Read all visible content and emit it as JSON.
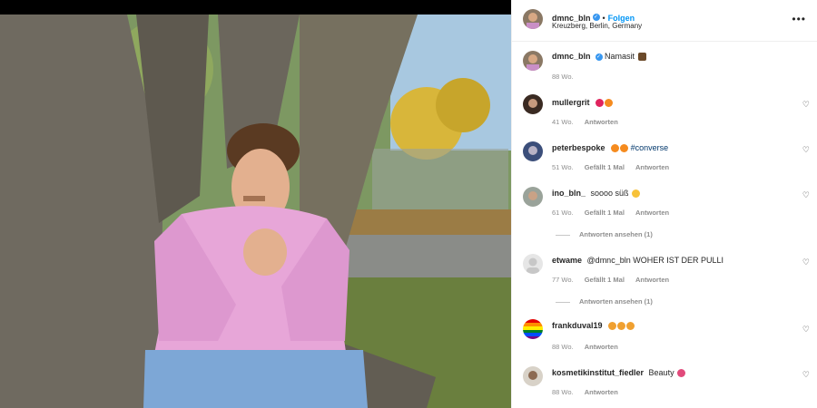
{
  "post": {
    "author": "dmnc_bln",
    "follow_label": "Folgen",
    "dot": "•",
    "location": "Kreuzberg, Berlin, Germany",
    "more": "•••",
    "verified_mark": "✓",
    "caption_text": "Namasit",
    "caption_age": "88 Wo."
  },
  "comments": [
    {
      "user": "mullergrit",
      "text": "",
      "emoji": [
        "heart-red",
        "fire"
      ],
      "age": "41 Wo.",
      "likes": "",
      "reply": "Antworten",
      "replies": ""
    },
    {
      "user": "peterbespoke",
      "text": "#converse",
      "emoji_before": [
        "fire",
        "fire"
      ],
      "age": "51 Wo.",
      "likes": "Gefällt 1 Mal",
      "reply": "Antworten",
      "replies": ""
    },
    {
      "user": "ino_bln_",
      "text": "soooo süß",
      "emoji": [
        "smile"
      ],
      "age": "61 Wo.",
      "likes": "Gefällt 1 Mal",
      "reply": "Antworten",
      "replies": "Antworten ansehen (1)"
    },
    {
      "user": "etwame",
      "text": "@dmnc_bln WOHER IST DER PULLI",
      "age": "77 Wo.",
      "likes": "Gefällt 1 Mal",
      "reply": "Antworten",
      "replies": "Antworten ansehen (1)"
    },
    {
      "user": "frankduval19",
      "text": "",
      "emoji": [
        "heart-eyes",
        "heart-eyes",
        "heart-eyes"
      ],
      "age": "88 Wo.",
      "likes": "",
      "reply": "Antworten",
      "replies": ""
    },
    {
      "user": "kosmetikinstitut_fiedler",
      "text": "Beauty",
      "emoji": [
        "heart-pink"
      ],
      "age": "88 Wo.",
      "likes": "",
      "reply": "Antworten",
      "replies": ""
    }
  ],
  "heart_glyph": "♡",
  "colors": {
    "link": "#0095f6",
    "muted": "#8e8e8e",
    "sweater": "#e7a6d8"
  }
}
